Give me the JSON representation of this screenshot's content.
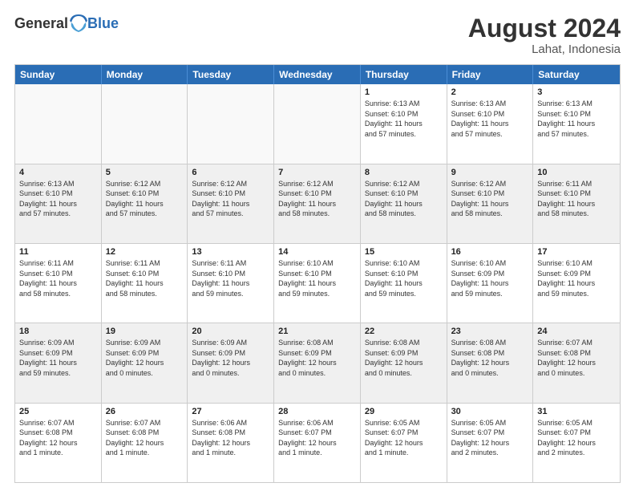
{
  "header": {
    "logo_general": "General",
    "logo_blue": "Blue",
    "month_year": "August 2024",
    "location": "Lahat, Indonesia"
  },
  "weekdays": [
    "Sunday",
    "Monday",
    "Tuesday",
    "Wednesday",
    "Thursday",
    "Friday",
    "Saturday"
  ],
  "rows": [
    [
      {
        "day": "",
        "text": "",
        "empty": true
      },
      {
        "day": "",
        "text": "",
        "empty": true
      },
      {
        "day": "",
        "text": "",
        "empty": true
      },
      {
        "day": "",
        "text": "",
        "empty": true
      },
      {
        "day": "1",
        "text": "Sunrise: 6:13 AM\nSunset: 6:10 PM\nDaylight: 11 hours\nand 57 minutes."
      },
      {
        "day": "2",
        "text": "Sunrise: 6:13 AM\nSunset: 6:10 PM\nDaylight: 11 hours\nand 57 minutes."
      },
      {
        "day": "3",
        "text": "Sunrise: 6:13 AM\nSunset: 6:10 PM\nDaylight: 11 hours\nand 57 minutes."
      }
    ],
    [
      {
        "day": "4",
        "text": "Sunrise: 6:13 AM\nSunset: 6:10 PM\nDaylight: 11 hours\nand 57 minutes."
      },
      {
        "day": "5",
        "text": "Sunrise: 6:12 AM\nSunset: 6:10 PM\nDaylight: 11 hours\nand 57 minutes."
      },
      {
        "day": "6",
        "text": "Sunrise: 6:12 AM\nSunset: 6:10 PM\nDaylight: 11 hours\nand 57 minutes."
      },
      {
        "day": "7",
        "text": "Sunrise: 6:12 AM\nSunset: 6:10 PM\nDaylight: 11 hours\nand 58 minutes."
      },
      {
        "day": "8",
        "text": "Sunrise: 6:12 AM\nSunset: 6:10 PM\nDaylight: 11 hours\nand 58 minutes."
      },
      {
        "day": "9",
        "text": "Sunrise: 6:12 AM\nSunset: 6:10 PM\nDaylight: 11 hours\nand 58 minutes."
      },
      {
        "day": "10",
        "text": "Sunrise: 6:11 AM\nSunset: 6:10 PM\nDaylight: 11 hours\nand 58 minutes."
      }
    ],
    [
      {
        "day": "11",
        "text": "Sunrise: 6:11 AM\nSunset: 6:10 PM\nDaylight: 11 hours\nand 58 minutes."
      },
      {
        "day": "12",
        "text": "Sunrise: 6:11 AM\nSunset: 6:10 PM\nDaylight: 11 hours\nand 58 minutes."
      },
      {
        "day": "13",
        "text": "Sunrise: 6:11 AM\nSunset: 6:10 PM\nDaylight: 11 hours\nand 59 minutes."
      },
      {
        "day": "14",
        "text": "Sunrise: 6:10 AM\nSunset: 6:10 PM\nDaylight: 11 hours\nand 59 minutes."
      },
      {
        "day": "15",
        "text": "Sunrise: 6:10 AM\nSunset: 6:10 PM\nDaylight: 11 hours\nand 59 minutes."
      },
      {
        "day": "16",
        "text": "Sunrise: 6:10 AM\nSunset: 6:09 PM\nDaylight: 11 hours\nand 59 minutes."
      },
      {
        "day": "17",
        "text": "Sunrise: 6:10 AM\nSunset: 6:09 PM\nDaylight: 11 hours\nand 59 minutes."
      }
    ],
    [
      {
        "day": "18",
        "text": "Sunrise: 6:09 AM\nSunset: 6:09 PM\nDaylight: 11 hours\nand 59 minutes."
      },
      {
        "day": "19",
        "text": "Sunrise: 6:09 AM\nSunset: 6:09 PM\nDaylight: 12 hours\nand 0 minutes."
      },
      {
        "day": "20",
        "text": "Sunrise: 6:09 AM\nSunset: 6:09 PM\nDaylight: 12 hours\nand 0 minutes."
      },
      {
        "day": "21",
        "text": "Sunrise: 6:08 AM\nSunset: 6:09 PM\nDaylight: 12 hours\nand 0 minutes."
      },
      {
        "day": "22",
        "text": "Sunrise: 6:08 AM\nSunset: 6:09 PM\nDaylight: 12 hours\nand 0 minutes."
      },
      {
        "day": "23",
        "text": "Sunrise: 6:08 AM\nSunset: 6:08 PM\nDaylight: 12 hours\nand 0 minutes."
      },
      {
        "day": "24",
        "text": "Sunrise: 6:07 AM\nSunset: 6:08 PM\nDaylight: 12 hours\nand 0 minutes."
      }
    ],
    [
      {
        "day": "25",
        "text": "Sunrise: 6:07 AM\nSunset: 6:08 PM\nDaylight: 12 hours\nand 1 minute."
      },
      {
        "day": "26",
        "text": "Sunrise: 6:07 AM\nSunset: 6:08 PM\nDaylight: 12 hours\nand 1 minute."
      },
      {
        "day": "27",
        "text": "Sunrise: 6:06 AM\nSunset: 6:08 PM\nDaylight: 12 hours\nand 1 minute."
      },
      {
        "day": "28",
        "text": "Sunrise: 6:06 AM\nSunset: 6:07 PM\nDaylight: 12 hours\nand 1 minute."
      },
      {
        "day": "29",
        "text": "Sunrise: 6:05 AM\nSunset: 6:07 PM\nDaylight: 12 hours\nand 1 minute."
      },
      {
        "day": "30",
        "text": "Sunrise: 6:05 AM\nSunset: 6:07 PM\nDaylight: 12 hours\nand 2 minutes."
      },
      {
        "day": "31",
        "text": "Sunrise: 6:05 AM\nSunset: 6:07 PM\nDaylight: 12 hours\nand 2 minutes."
      }
    ]
  ]
}
